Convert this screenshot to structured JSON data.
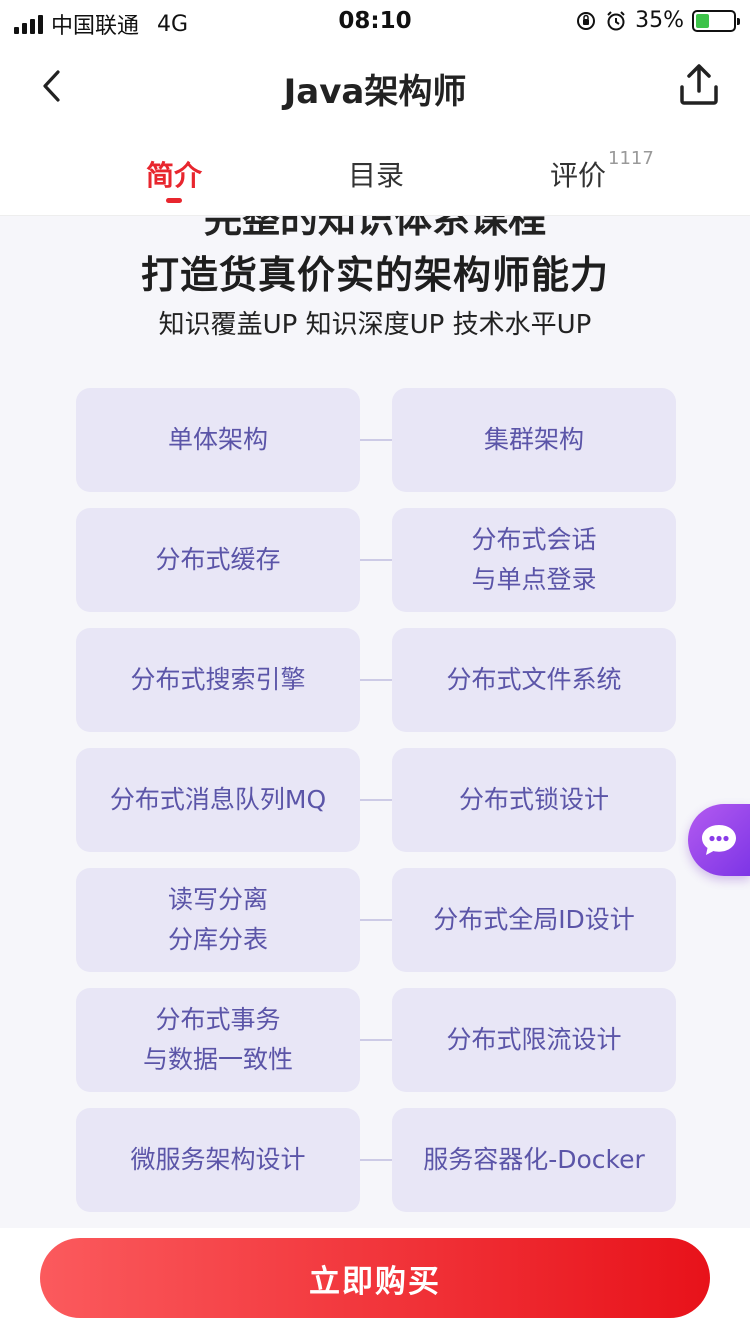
{
  "status": {
    "carrier": "中国联通",
    "network": "4G",
    "time": "08:10",
    "battery": "35%",
    "battery_level": 0.35
  },
  "nav": {
    "title": "Java架构师",
    "back_icon": "chevron-left-icon",
    "share_icon": "share-upload-icon"
  },
  "tabs": [
    {
      "label": "简介",
      "active": true
    },
    {
      "label": "目录",
      "active": false
    },
    {
      "label": "评价",
      "active": false,
      "badge": "1117"
    }
  ],
  "intro": {
    "headline_cut": "完整的知识体系课程",
    "headline": "打造货真价实的架构师能力",
    "subline": "知识覆盖UP 知识深度UP 技术水平UP"
  },
  "topics": [
    {
      "left": [
        "单体架构"
      ],
      "right": [
        "集群架构"
      ]
    },
    {
      "left": [
        "分布式缓存"
      ],
      "right": [
        "分布式会话",
        "与单点登录"
      ]
    },
    {
      "left": [
        "分布式搜索引擎"
      ],
      "right": [
        "分布式文件系统"
      ]
    },
    {
      "left": [
        "分布式消息队列MQ"
      ],
      "right": [
        "分布式锁设计"
      ]
    },
    {
      "left": [
        "读写分离",
        "分库分表"
      ],
      "right": [
        "分布式全局ID设计"
      ]
    },
    {
      "left": [
        "分布式事务",
        "与数据一致性"
      ],
      "right": [
        "分布式限流设计"
      ]
    },
    {
      "left": [
        "微服务架构设计"
      ],
      "right": [
        "服务容器化-Docker"
      ]
    }
  ],
  "chat_icon": "chat-bubble-icon",
  "buy_button": "立即购买",
  "colors": {
    "accent_red": "#e8262e",
    "card_bg": "#e8e6f6",
    "card_text": "#5b55a8",
    "chat_purple": "#8a3ce8"
  }
}
